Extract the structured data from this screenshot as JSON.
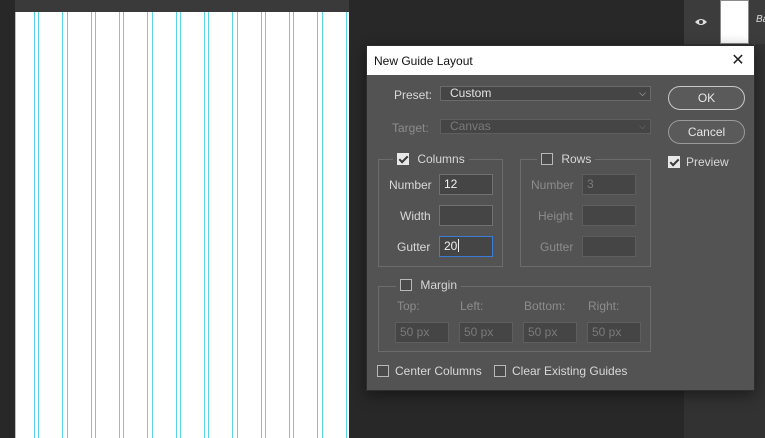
{
  "dialog": {
    "title": "New Guide Layout",
    "close_glyph": "✕",
    "preset_label": "Preset:",
    "preset_value": "Custom",
    "target_label": "Target:",
    "target_value": "Canvas",
    "ok_label": "OK",
    "cancel_label": "Cancel",
    "preview_label": "Preview",
    "preview_checked": true,
    "columns": {
      "label": "Columns",
      "checked": true,
      "number_label": "Number",
      "number_value": "12",
      "width_label": "Width",
      "width_value": "",
      "gutter_label": "Gutter",
      "gutter_value": "20"
    },
    "rows": {
      "label": "Rows",
      "checked": false,
      "number_label": "Number",
      "number_value": "3",
      "height_label": "Height",
      "height_value": "",
      "gutter_label": "Gutter",
      "gutter_value": ""
    },
    "margin": {
      "label": "Margin",
      "checked": false,
      "top_label": "Top:",
      "left_label": "Left:",
      "bottom_label": "Bottom:",
      "right_label": "Right:",
      "top_value": "50 px",
      "left_value": "50 px",
      "bottom_value": "50 px",
      "right_value": "50 px"
    },
    "center_columns_label": "Center Columns",
    "center_columns_checked": false,
    "clear_guides_label": "Clear Existing Guides",
    "clear_guides_checked": false
  },
  "layers_panel": {
    "layer_name": "Ba",
    "eye_icon": "eye-icon"
  },
  "colors": {
    "guide": "#58d4e6",
    "dialog_bg": "#535353",
    "focus": "#3d7bd8"
  }
}
